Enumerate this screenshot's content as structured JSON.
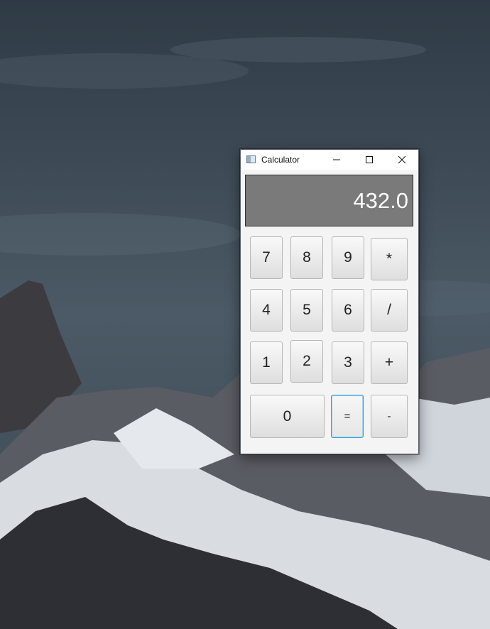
{
  "window": {
    "title": "Calculator",
    "controls": [
      "minimize",
      "maximize",
      "close"
    ]
  },
  "display": {
    "value": "432.0"
  },
  "keys": {
    "k7": "7",
    "k8": "8",
    "k9": "9",
    "mul": "*",
    "k4": "4",
    "k5": "5",
    "k6": "6",
    "div": "/",
    "k1": "1",
    "k2": "2",
    "k3": "3",
    "add": "+",
    "k0": "0",
    "eq": "=",
    "sub": "-"
  },
  "focused_key": "="
}
